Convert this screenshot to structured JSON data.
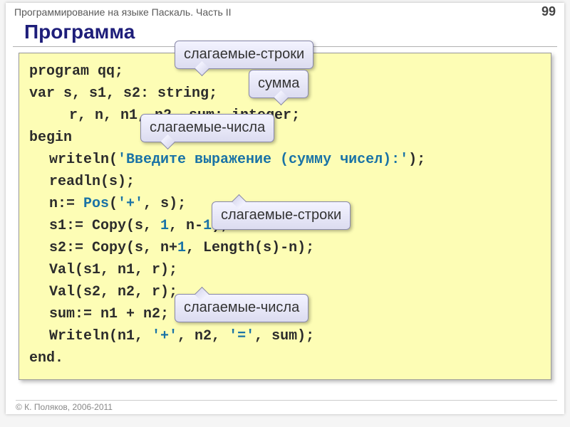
{
  "header": {
    "subject": "Программирование на языке Паскаль. Часть II",
    "page_number": "99"
  },
  "title": "Программа",
  "code": {
    "l1_a": "program",
    "l1_b": " qq;",
    "l2_a": "var",
    "l2_b": " s, s1, s2: ",
    "l2_c": "string",
    "l2_d": ";",
    "l3_a": "r, n, n1, n2, sum: ",
    "l3_b": "integer",
    "l3_c": ";",
    "l4": "begin",
    "l5_a": "writeln(",
    "l5_b": "'Введите выражение (сумму чисел):'",
    "l5_c": ");",
    "l6": "readln(s);",
    "l7_a": "n:= ",
    "l7_b": "Pos",
    "l7_c": "(",
    "l7_d": "'+'",
    "l7_e": ", s);",
    "l8_a": "s1:= Copy(s, ",
    "l8_b": "1",
    "l8_c": ", n-",
    "l8_d": "1",
    "l8_e": ");",
    "l9_a": "s2:= Copy(s, n+",
    "l9_b": "1",
    "l9_c": ", Length(s)-n);",
    "l10": "Val(s1, n1, r);",
    "l11": "Val(s2, n2, r);",
    "l12": "sum:= n1 + n2;",
    "l13_a": "Writeln(n1, ",
    "l13_b": "'+'",
    "l13_c": ", n2, ",
    "l13_d": "'='",
    "l13_e": ", sum);",
    "l14": "end."
  },
  "callouts": {
    "c1": "слагаемые-строки",
    "c2": "сумма",
    "c3": "слагаемые-числа",
    "c4": "слагаемые-строки",
    "c5": "слагаемые-числа"
  },
  "footer": "© К. Поляков, 2006-2011"
}
